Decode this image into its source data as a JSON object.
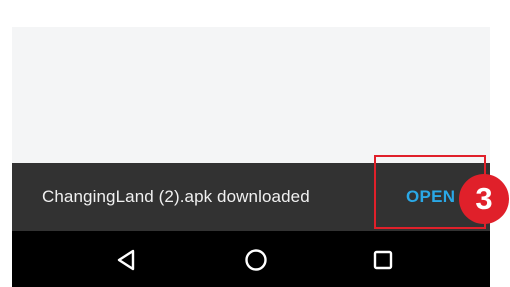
{
  "snackbar": {
    "message": "ChangingLand (2).apk downloaded",
    "action_label": "OPEN",
    "action_color": "#2aa8e6",
    "background": "#323232"
  },
  "annotation": {
    "step_number": "3",
    "highlight_color": "#e0202a"
  },
  "navbar": {
    "buttons": [
      {
        "name": "back-icon"
      },
      {
        "name": "home-icon"
      },
      {
        "name": "recents-icon"
      }
    ]
  }
}
